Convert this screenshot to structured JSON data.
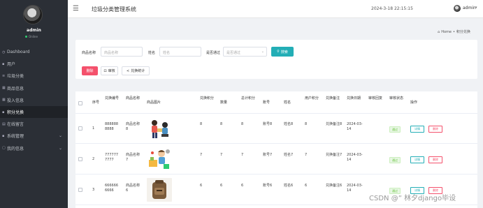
{
  "sidebar": {
    "user_name": "admin",
    "status": "Online",
    "items": [
      {
        "label": "Dashboard",
        "icon": "dashboard-icon",
        "glyph": "◷",
        "active": false
      },
      {
        "label": "用户",
        "icon": "user-icon",
        "glyph": "▪",
        "active": false
      },
      {
        "label": "垃圾分类",
        "icon": "list-icon",
        "glyph": "≡",
        "active": false
      },
      {
        "label": "商品信息",
        "icon": "grid-icon",
        "glyph": "▦",
        "active": false
      },
      {
        "label": "投入信息",
        "icon": "grid-icon",
        "glyph": "▦",
        "active": false
      },
      {
        "label": "积分兑换",
        "icon": "exchange-icon",
        "glyph": "▪",
        "active": true
      },
      {
        "label": "在线留言",
        "icon": "message-icon",
        "glyph": "▤",
        "active": false
      },
      {
        "label": "系统管理",
        "icon": "settings-icon",
        "glyph": "▪",
        "active": false,
        "has_children": true
      },
      {
        "label": "我的信息",
        "icon": "profile-icon",
        "glyph": "▢",
        "active": false,
        "has_children": true
      }
    ]
  },
  "header": {
    "menu_icon": "hamburger-icon",
    "title": "垃圾分类管理系统",
    "datetime": "2024-3-18 22:15:15",
    "user": "admin"
  },
  "breadcrumb": {
    "home": "Home",
    "separator": "•",
    "current": "积分兑换"
  },
  "search": {
    "product_label": "商品名称",
    "product_placeholder": "商品名称",
    "name_label": "姓名",
    "name_placeholder": "姓名",
    "approved_label": "是否通过",
    "approved_placeholder": "是否通过",
    "search_button": "搜索"
  },
  "actions": {
    "delete": "删除",
    "review": "审核",
    "stats": "兑换统计"
  },
  "table": {
    "headers": {
      "index": "序号",
      "code": "兑换编号",
      "product": "商品名称",
      "image": "商品图片",
      "points": "兑换积分",
      "quantity": "数量",
      "total": "总计积分",
      "account": "账号",
      "name": "姓名",
      "user_points": "用户积分",
      "remark": "兑换备注",
      "date": "兑换日期",
      "review_reply": "审核回复",
      "review_status": "审核状态",
      "ops": "操作"
    },
    "rows": [
      {
        "index": "1",
        "code": "8888888888",
        "product": "商品名称8",
        "image": "people-exchange-image",
        "points": "8",
        "quantity": "8",
        "total": "8",
        "account": "账号8",
        "name": "姓名8",
        "user_points": "8",
        "remark": "兑换备注8",
        "date": "2024-03-14",
        "status": "通过",
        "detail": "详情",
        "delete": "删除"
      },
      {
        "index": "2",
        "code": "7777777777",
        "product": "商品名称7",
        "image": "recycling-character-image",
        "points": "7",
        "quantity": "7",
        "total": "7",
        "account": "账号7",
        "name": "姓名7",
        "user_points": "7",
        "remark": "兑换备注7",
        "date": "2024-03-14",
        "status": "通过",
        "detail": "详情",
        "delete": "删除"
      },
      {
        "index": "3",
        "code": "6666666666",
        "product": "商品名称6",
        "image": "backpack-image",
        "points": "6",
        "quantity": "6",
        "total": "6",
        "account": "账号6",
        "name": "姓名6",
        "user_points": "6",
        "remark": "兑换备注6",
        "date": "2024-03-14",
        "status": "通过",
        "detail": "详情",
        "delete": "删除"
      }
    ]
  },
  "watermark": "CSDN @” 林夕django毕设",
  "colors": {
    "sidebar_bg": "#2b2f36",
    "primary": "#23aeb6",
    "danger": "#f4516c",
    "success": "#67c23a"
  }
}
